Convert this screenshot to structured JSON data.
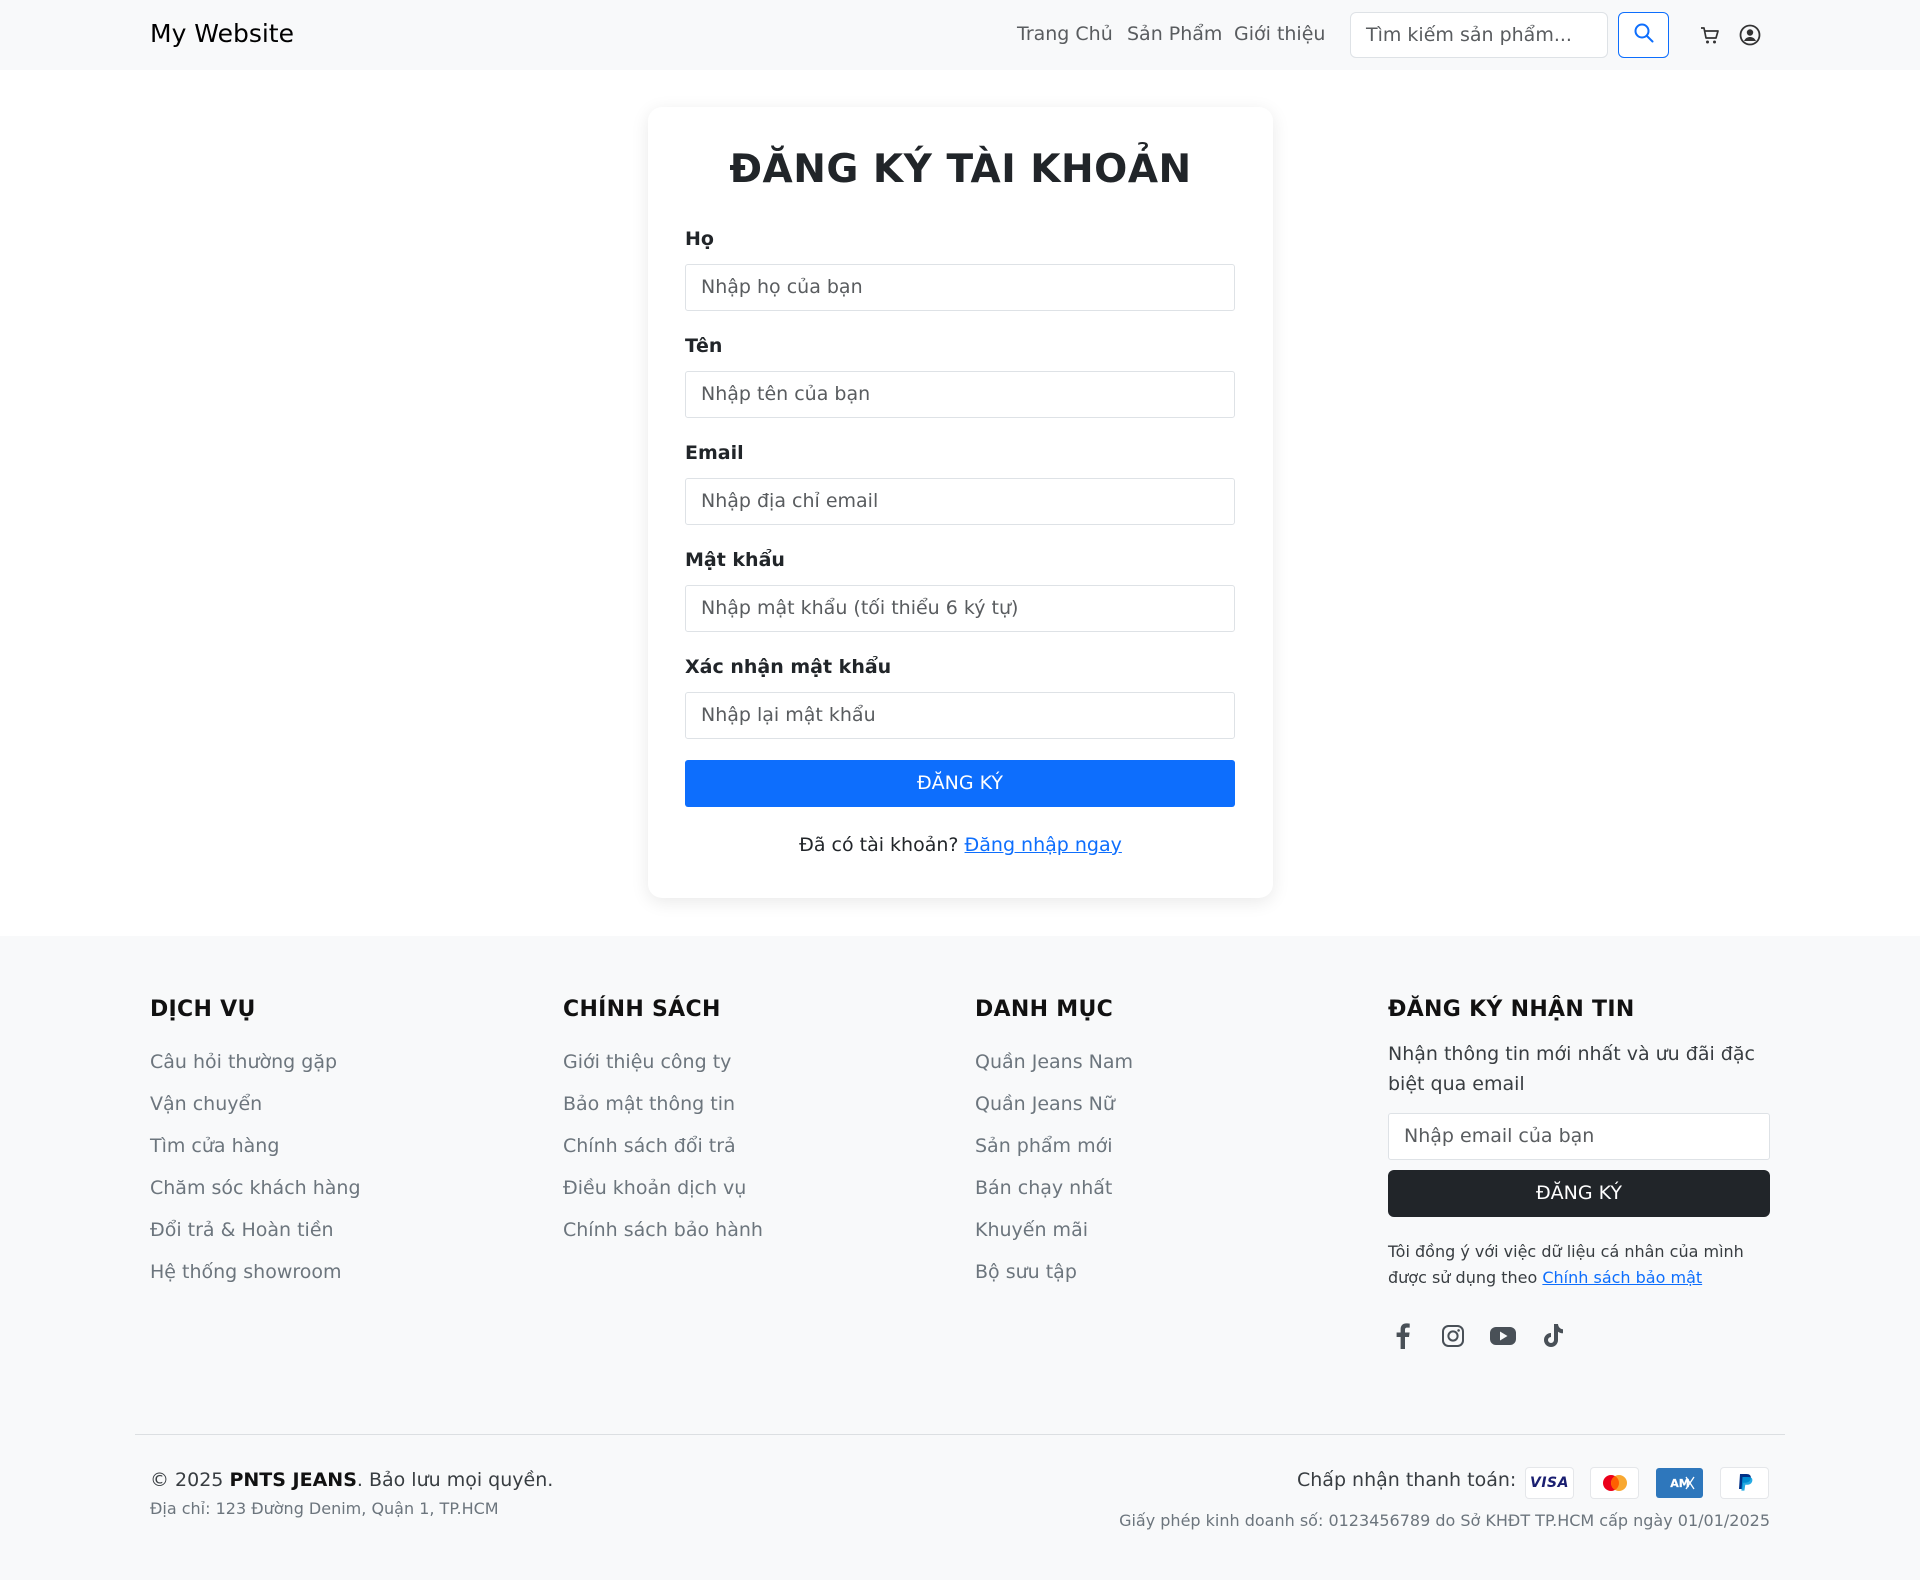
{
  "navbar": {
    "brand": "My Website",
    "links": [
      "Trang Chủ",
      "Sản Phẩm",
      "Giới thiệu"
    ],
    "search_placeholder": "Tìm kiếm sản phẩm...",
    "icons": [
      "search-icon",
      "cart-icon",
      "user-icon"
    ]
  },
  "form": {
    "title": "ĐĂNG KÝ TÀI KHOẢN",
    "fields": [
      {
        "label": "Họ",
        "placeholder": "Nhập họ của bạn"
      },
      {
        "label": "Tên",
        "placeholder": "Nhập tên của bạn"
      },
      {
        "label": "Email",
        "placeholder": "Nhập địa chỉ email"
      },
      {
        "label": "Mật khẩu",
        "placeholder": "Nhập mật khẩu (tối thiểu 6 ký tự)"
      },
      {
        "label": "Xác nhận mật khẩu",
        "placeholder": "Nhập lại mật khẩu"
      }
    ],
    "submit_label": "ĐĂNG KÝ",
    "login_prompt": "Đã có tài khoản?",
    "login_link": "Đăng nhập ngay"
  },
  "footer": {
    "columns": [
      {
        "heading": "DỊCH VỤ",
        "links": [
          "Câu hỏi thường gặp",
          "Vận chuyển",
          "Tìm cửa hàng",
          "Chăm sóc khách hàng",
          "Đổi trả & Hoàn tiền",
          "Hệ thống showroom"
        ]
      },
      {
        "heading": "CHÍNH SÁCH",
        "links": [
          "Giới thiệu công ty",
          "Bảo mật thông tin",
          "Chính sách đổi trả",
          "Điều khoản dịch vụ",
          "Chính sách bảo hành"
        ]
      },
      {
        "heading": "DANH MỤC",
        "links": [
          "Quần Jeans Nam",
          "Quần Jeans Nữ",
          "Sản phẩm mới",
          "Bán chạy nhất",
          "Khuyến mãi",
          "Bộ sưu tập"
        ]
      }
    ],
    "newsletter": {
      "heading": "ĐĂNG KÝ NHẬN TIN",
      "text": "Nhận thông tin mới nhất và ưu đãi đặc biệt qua email",
      "placeholder": "Nhập email của bạn",
      "button": "ĐĂNG KÝ",
      "consent": "Tôi đồng ý với việc dữ liệu cá nhân của mình được sử dụng theo",
      "consent_link": "Chính sách bảo mật",
      "socials": [
        "facebook-icon",
        "instagram-icon",
        "youtube-icon",
        "tiktok-icon"
      ]
    },
    "copyright_prefix": "© 2025",
    "brand_name": "PNTS JEANS",
    "copyright_suffix": ". Bảo lưu mọi quyền.",
    "address": "Địa chỉ: 123 Đường Denim, Quận 1, TP.HCM",
    "payment_label": "Chấp nhận thanh toán:",
    "payment_methods": [
      "VISA",
      "Mastercard",
      "American Express",
      "PayPal"
    ],
    "license": "Giấy phép kinh doanh số: 0123456789 do Sở KHĐT TP.HCM cấp ngày 01/01/2025"
  }
}
